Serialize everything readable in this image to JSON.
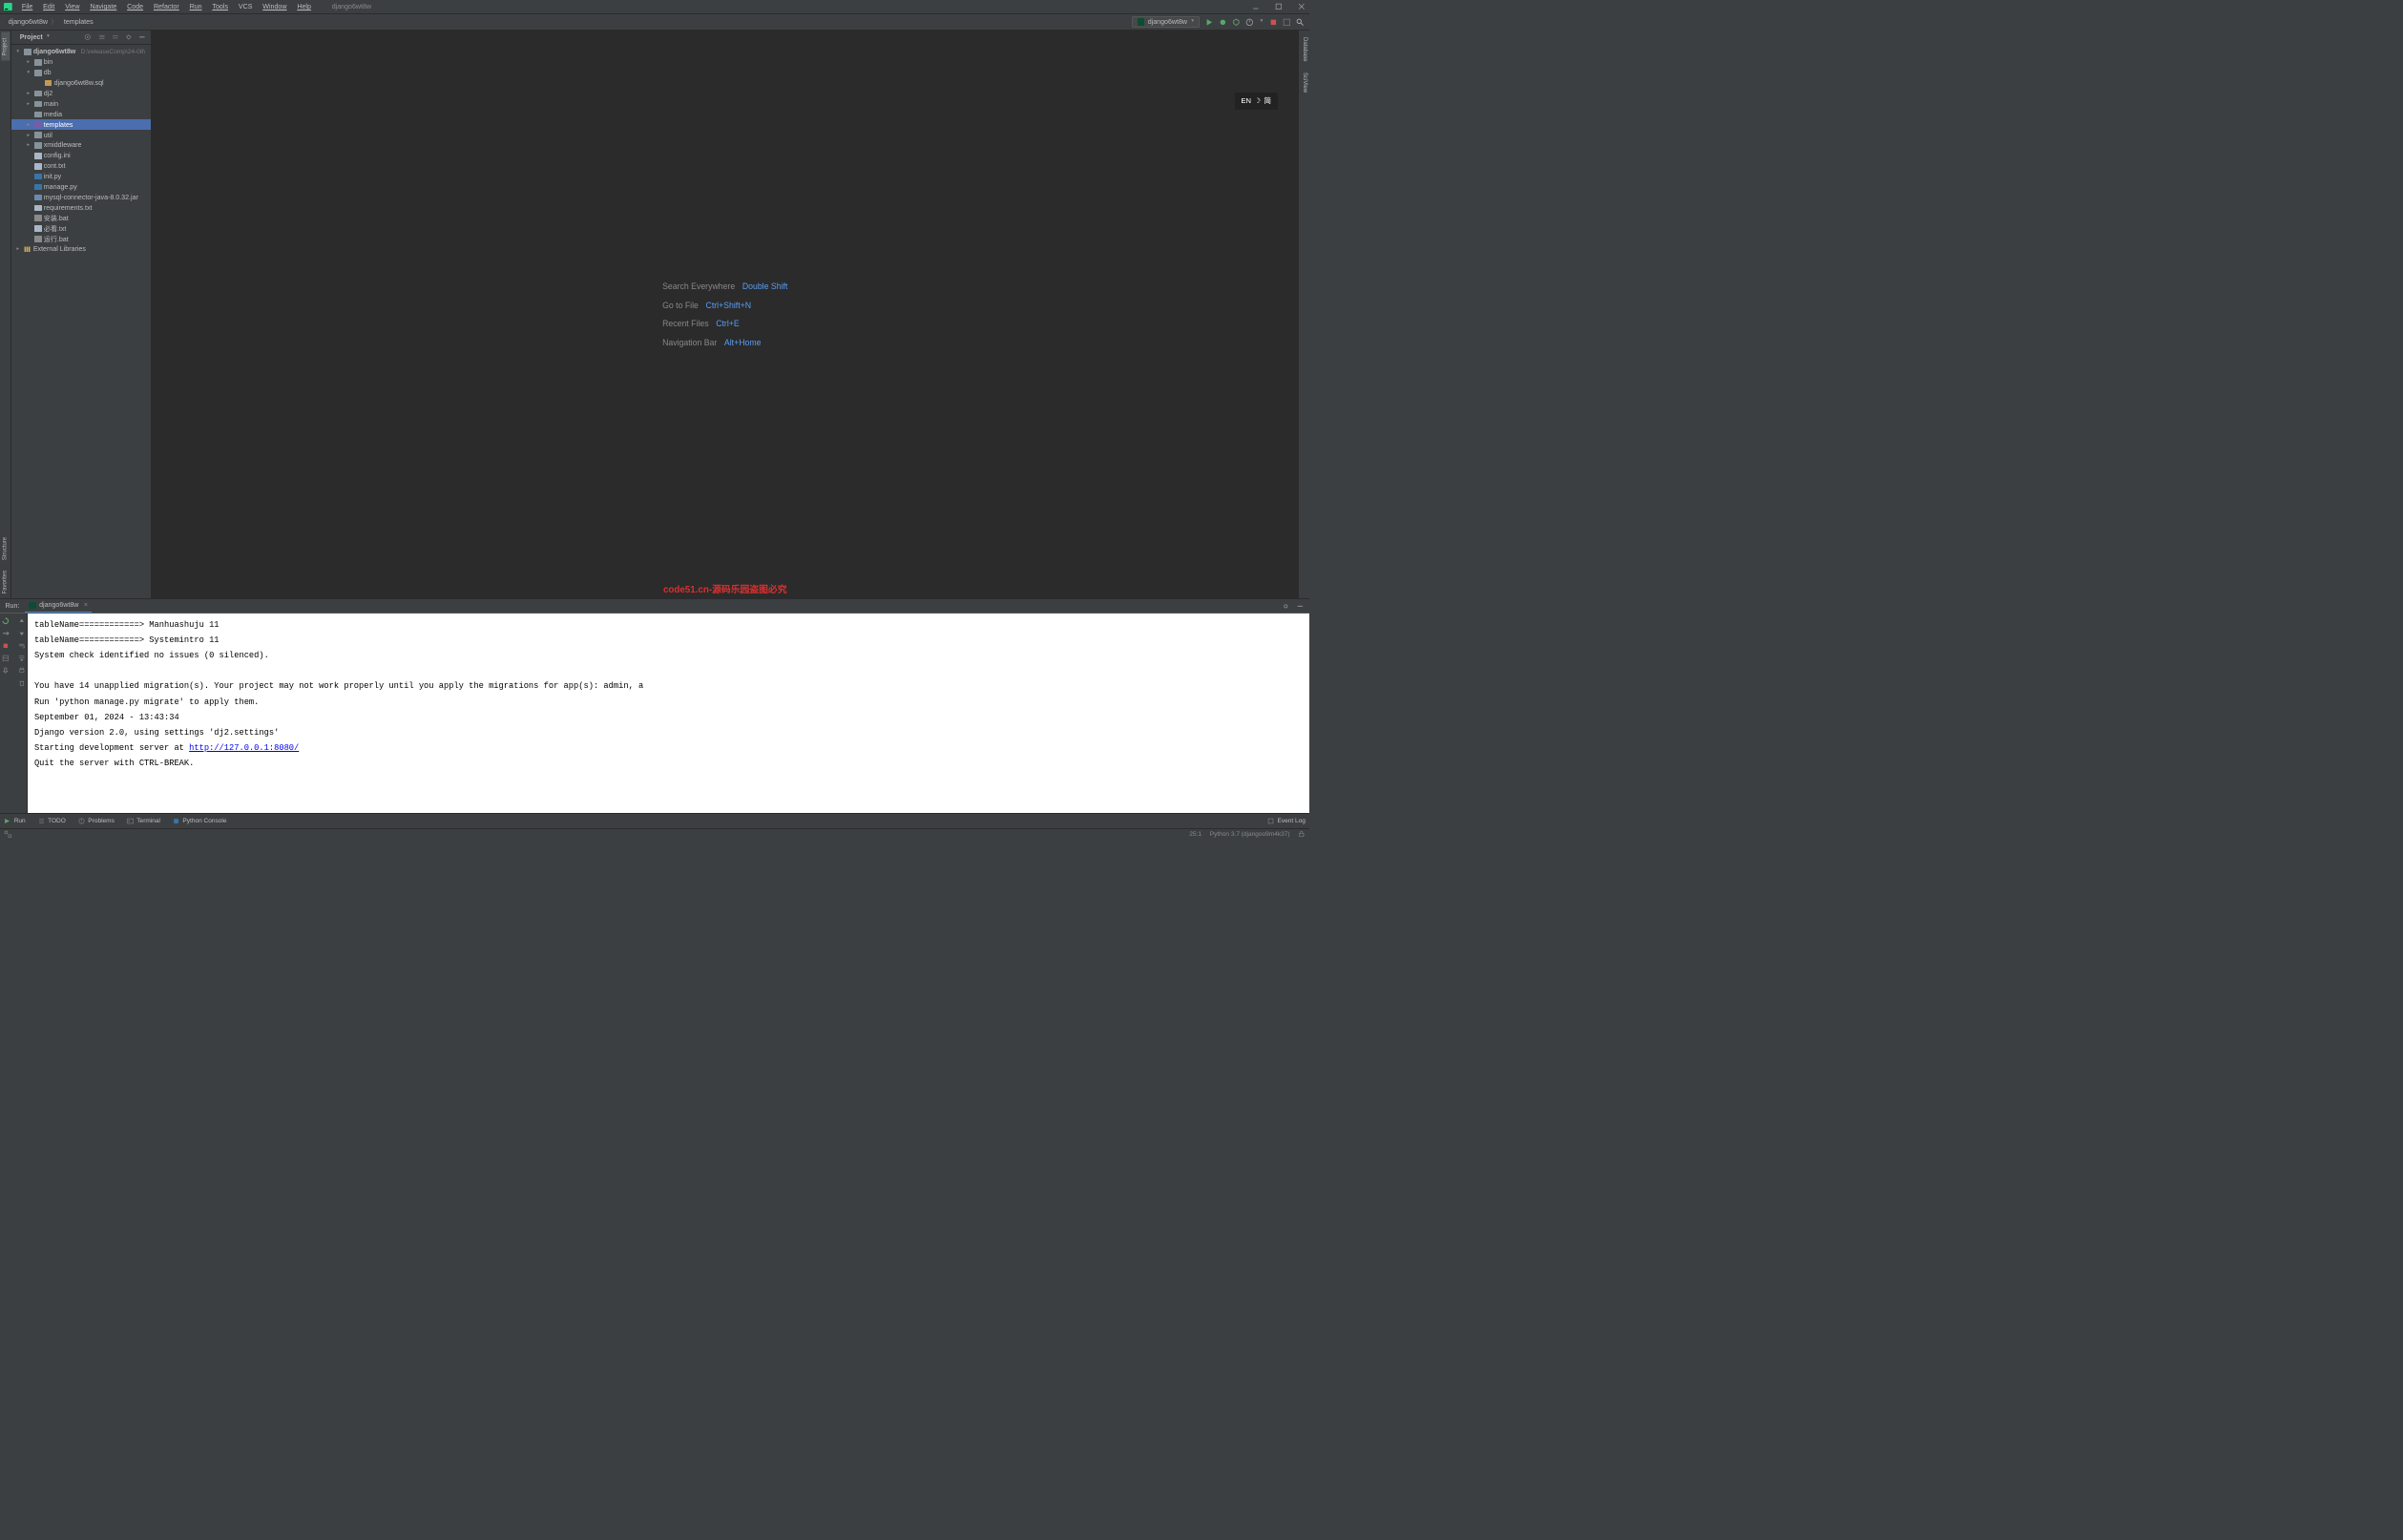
{
  "menu": [
    "File",
    "Edit",
    "View",
    "Navigate",
    "Code",
    "Refactor",
    "Run",
    "Tools",
    "VCS",
    "Window",
    "Help"
  ],
  "window_title": "django6wt8w",
  "breadcrumb": {
    "parts": [
      "django6wt8w",
      "templates"
    ]
  },
  "run_config": "django6wt8w",
  "ime": {
    "lang": "EN",
    "method": "简"
  },
  "project": {
    "title": "Project",
    "root": {
      "name": "django6wt8w",
      "path": "D:\\releaseComp\\24-08\\"
    },
    "tree": [
      {
        "name": "bin",
        "type": "folder",
        "indent": 1,
        "arrow": ">"
      },
      {
        "name": "db",
        "type": "folder-open",
        "indent": 1,
        "arrow": "v"
      },
      {
        "name": "django6wt8w.sql",
        "type": "sql",
        "indent": 2,
        "arrow": ""
      },
      {
        "name": "dj2",
        "type": "folder",
        "indent": 1,
        "arrow": ">"
      },
      {
        "name": "main",
        "type": "folder",
        "indent": 1,
        "arrow": ">"
      },
      {
        "name": "media",
        "type": "folder",
        "indent": 1,
        "arrow": ""
      },
      {
        "name": "templates",
        "type": "folder-purple",
        "indent": 1,
        "arrow": ">",
        "selected": true
      },
      {
        "name": "util",
        "type": "folder",
        "indent": 1,
        "arrow": ">"
      },
      {
        "name": "xmiddleware",
        "type": "folder",
        "indent": 1,
        "arrow": ">"
      },
      {
        "name": "config.ini",
        "type": "file",
        "indent": 1,
        "arrow": ""
      },
      {
        "name": "cont.txt",
        "type": "txt",
        "indent": 1,
        "arrow": ""
      },
      {
        "name": "init.py",
        "type": "py",
        "indent": 1,
        "arrow": ""
      },
      {
        "name": "manage.py",
        "type": "py",
        "indent": 1,
        "arrow": ""
      },
      {
        "name": "mysql-connector-java-8.0.32.jar",
        "type": "jar",
        "indent": 1,
        "arrow": ""
      },
      {
        "name": "requirements.txt",
        "type": "txt",
        "indent": 1,
        "arrow": ""
      },
      {
        "name": "安装.bat",
        "type": "bat",
        "indent": 1,
        "arrow": ""
      },
      {
        "name": "必看.txt",
        "type": "txt",
        "indent": 1,
        "arrow": ""
      },
      {
        "name": "运行.bat",
        "type": "bat",
        "indent": 1,
        "arrow": ""
      }
    ],
    "external_libs": "External Libraries"
  },
  "editor_hints": [
    {
      "label": "Search Everywhere",
      "shortcut": "Double Shift"
    },
    {
      "label": "Go to File",
      "shortcut": "Ctrl+Shift+N"
    },
    {
      "label": "Recent Files",
      "shortcut": "Ctrl+E"
    },
    {
      "label": "Navigation Bar",
      "shortcut": "Alt+Home"
    }
  ],
  "red_watermark": "code51.cn-源码乐园盗图必究",
  "run_panel": {
    "label": "Run:",
    "tab": "django6wt8w",
    "output_lines": [
      "tableName============> Manhuashuju 11",
      "tableName============> Systemintro 11",
      "System check identified no issues (0 silenced).",
      "",
      "You have 14 unapplied migration(s). Your project may not work properly until you apply the migrations for app(s): admin, a",
      "Run 'python manage.py migrate' to apply them.",
      "September 01, 2024 - 13:43:34",
      "Django version 2.0, using settings 'dj2.settings'"
    ],
    "server_line_prefix": "Starting development server at ",
    "server_url": "http://127.0.0.1:8080/",
    "quit_line": "Quit the server with CTRL-BREAK."
  },
  "bottom_tools": {
    "run": "Run",
    "todo": "TODO",
    "problems": "Problems",
    "terminal": "Terminal",
    "python_console": "Python Console",
    "event_log": "Event Log"
  },
  "status": {
    "pos": "25:1",
    "python": "Python 3.7 (djangoo9m4k37)"
  },
  "side_tabs_left": [
    "Project",
    "Structure",
    "Favorites"
  ],
  "side_tabs_right": [
    "Database",
    "SciView"
  ],
  "toolbar_icons": [
    "run",
    "debug",
    "coverage",
    "profile",
    "stop",
    "git",
    "search"
  ]
}
